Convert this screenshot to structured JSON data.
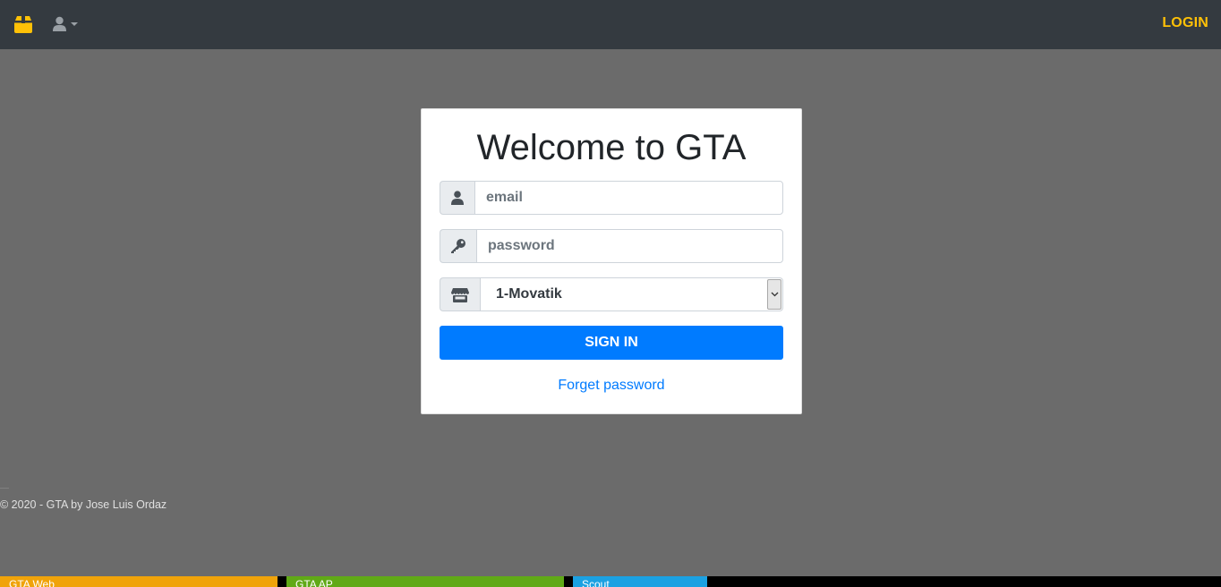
{
  "navbar": {
    "brand_icon": "box-icon",
    "user_icon": "user-icon",
    "login_label": "LOGIN",
    "accent_color": "#ffc107"
  },
  "login_card": {
    "title": "Welcome to GTA",
    "email": {
      "placeholder": "email",
      "icon": "user-icon"
    },
    "password": {
      "placeholder": "password",
      "icon": "key-icon"
    },
    "store": {
      "selected": "1-Movatik",
      "icon": "store-icon"
    },
    "signin_label": "SIGN IN",
    "forgot_label": "Forget password",
    "primary_color": "#007bff"
  },
  "footer": {
    "copyright": "© 2020 - GTA by Jose Luis Ordaz"
  },
  "taskbar": {
    "items": [
      {
        "label": "GTA Web",
        "color": "#f0a30a"
      },
      {
        "label": "GTA AP",
        "color": "#60a917"
      },
      {
        "label": "Scout",
        "color": "#1ba1e2"
      }
    ]
  }
}
